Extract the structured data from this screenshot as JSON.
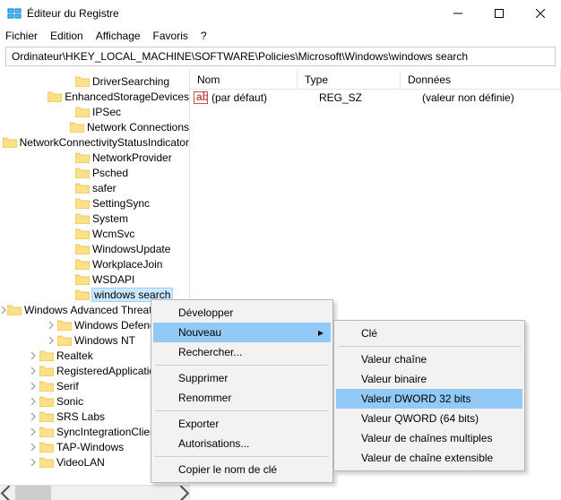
{
  "window": {
    "title": "Éditeur du Registre"
  },
  "menu": {
    "file": "Fichier",
    "edit": "Edition",
    "view": "Affichage",
    "favorites": "Favoris",
    "help": "?"
  },
  "address": "Ordinateur\\HKEY_LOCAL_MACHINE\\SOFTWARE\\Policies\\Microsoft\\Windows\\windows search",
  "tree": [
    {
      "d": 7,
      "chev": false,
      "label": "DriverSearching"
    },
    {
      "d": 7,
      "chev": false,
      "label": "EnhancedStorageDevices"
    },
    {
      "d": 7,
      "chev": false,
      "label": "IPSec"
    },
    {
      "d": 7,
      "chev": false,
      "label": "Network Connections"
    },
    {
      "d": 7,
      "chev": false,
      "label": "NetworkConnectivityStatusIndicator"
    },
    {
      "d": 7,
      "chev": false,
      "label": "NetworkProvider"
    },
    {
      "d": 7,
      "chev": false,
      "label": "Psched"
    },
    {
      "d": 7,
      "chev": false,
      "label": "safer"
    },
    {
      "d": 7,
      "chev": false,
      "label": "SettingSync"
    },
    {
      "d": 7,
      "chev": false,
      "label": "System"
    },
    {
      "d": 7,
      "chev": false,
      "label": "WcmSvc"
    },
    {
      "d": 7,
      "chev": false,
      "label": "WindowsUpdate"
    },
    {
      "d": 7,
      "chev": false,
      "label": "WorkplaceJoin"
    },
    {
      "d": 7,
      "chev": false,
      "label": "WSDAPI"
    },
    {
      "d": 7,
      "chev": false,
      "label": "windows search",
      "sel": true
    },
    {
      "d": 5,
      "chev": "r",
      "label": "Windows Advanced Threat Protection"
    },
    {
      "d": 5,
      "chev": "r",
      "label": "Windows Defender"
    },
    {
      "d": 5,
      "chev": "r",
      "label": "Windows NT"
    },
    {
      "d": 3,
      "chev": "r",
      "label": "Realtek"
    },
    {
      "d": 3,
      "chev": "r",
      "label": "RegisteredApplications"
    },
    {
      "d": 3,
      "chev": "r",
      "label": "Serif"
    },
    {
      "d": 3,
      "chev": "r",
      "label": "Sonic"
    },
    {
      "d": 3,
      "chev": "r",
      "label": "SRS Labs"
    },
    {
      "d": 3,
      "chev": "r",
      "label": "SyncIntegrationClients"
    },
    {
      "d": 3,
      "chev": "r",
      "label": "TAP-Windows"
    },
    {
      "d": 3,
      "chev": "r",
      "label": "VideoLAN"
    }
  ],
  "list": {
    "headers": {
      "name": "Nom",
      "type": "Type",
      "data": "Données"
    },
    "rows": [
      {
        "name": "(par défaut)",
        "type": "REG_SZ",
        "data": "(valeur non définie)"
      }
    ]
  },
  "ctx1": {
    "expand": "Développer",
    "new": "Nouveau",
    "find": "Rechercher...",
    "delete": "Supprimer",
    "rename": "Renommer",
    "export": "Exporter",
    "permissions": "Autorisations...",
    "copykey": "Copier le nom de clé"
  },
  "ctx2": {
    "key": "Clé",
    "string": "Valeur chaîne",
    "binary": "Valeur binaire",
    "dword": "Valeur DWORD 32 bits",
    "qword": "Valeur QWORD (64 bits)",
    "multi": "Valeur de chaînes multiples",
    "expand": "Valeur de chaîne extensible"
  }
}
